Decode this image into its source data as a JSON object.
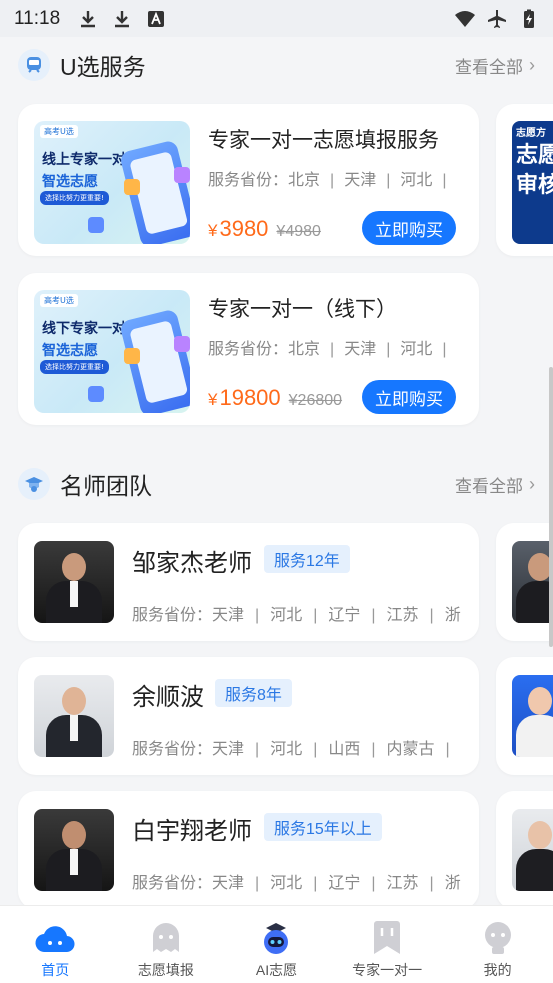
{
  "status_bar": {
    "time": "11:18"
  },
  "services": {
    "title": "U选服务",
    "view_all": "查看全部",
    "items": [
      {
        "thumb_brand": "高考U选",
        "thumb_line1": "线上专家一对一",
        "thumb_line2": "智选志愿",
        "thumb_tag": "选择比努力更重要!",
        "title": "专家一对一志愿填报服务",
        "provinces_label": "服务省份：",
        "provinces": [
          "北京",
          "天津",
          "河北"
        ],
        "price": "3980",
        "original_price": "¥4980",
        "buy_label": "立即购买"
      },
      {
        "thumb_brand": "高考U选",
        "thumb_line1": "线下专家一对一",
        "thumb_line2": "智选志愿",
        "thumb_tag": "选择比努力更重要!",
        "title": "专家一对一（线下）",
        "provinces_label": "服务省份：",
        "provinces": [
          "北京",
          "天津",
          "河北"
        ],
        "price": "19800",
        "original_price": "¥26800",
        "buy_label": "立即购买"
      }
    ],
    "peek_text": {
      "line1": "志愿方",
      "line2": "志愿",
      "line3": "审核"
    }
  },
  "teachers": {
    "title": "名师团队",
    "view_all": "查看全部",
    "items": [
      {
        "name": "邹家杰老师",
        "badge": "服务12年",
        "provinces_label": "服务省份：",
        "provinces": [
          "天津",
          "河北",
          "辽宁",
          "江苏",
          "浙"
        ]
      },
      {
        "name": "余顺波",
        "badge": "服务8年",
        "provinces_label": "服务省份：",
        "provinces": [
          "天津",
          "河北",
          "山西",
          "内蒙古"
        ]
      },
      {
        "name": "白宇翔老师",
        "badge": "服务15年以上",
        "provinces_label": "服务省份：",
        "provinces": [
          "天津",
          "河北",
          "辽宁",
          "江苏",
          "浙"
        ]
      }
    ]
  },
  "tab_bar": {
    "tabs": [
      {
        "label": "首页",
        "icon": "cloud-home-icon",
        "active": true
      },
      {
        "label": "志愿填报",
        "icon": "ghost-form-icon",
        "active": false
      },
      {
        "label": "AI志愿",
        "icon": "robot-ai-icon",
        "active": false
      },
      {
        "label": "专家一对一",
        "icon": "bookmark-icon",
        "active": false
      },
      {
        "label": "我的",
        "icon": "profile-icon",
        "active": false
      }
    ]
  },
  "colors": {
    "accent": "#1677ff",
    "price": "#ff6a1a",
    "badge_bg": "#e5f0fd",
    "badge_text": "#2b78e4",
    "background": "#f4f5f7"
  }
}
